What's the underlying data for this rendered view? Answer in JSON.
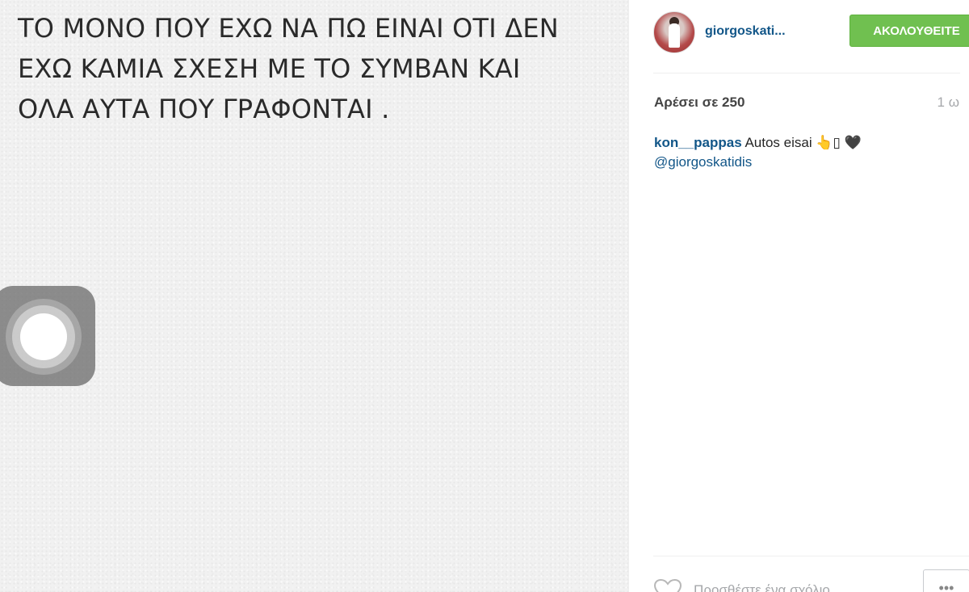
{
  "photo": {
    "caption_lines": [
      "ΤΟ ΜΟΝΟ ΠΟΥ ΕΧΩ ΝΑ ΠΩ ΕΙΝΑΙ ΟΤΙ ΔΕΝ",
      "ΕΧΩ ΚΑΜΙΑ ΣΧΕΣΗ ΜΕ ΤΟ ΣΥΜΒΑΝ ΚΑΙ",
      "ΟΛΑ ΑΥΤΑ ΠΟΥ ΓΡΑΦΟΝΤΑΙ ."
    ]
  },
  "assistive_touch": {
    "icon": "assistive-touch-icon"
  },
  "post": {
    "author_display": "giorgoskati...",
    "follow_label": "ΑΚΟΛΟΥΘΕΙΤΕ",
    "likes_label": "Αρέσει σε 250",
    "time_ago": "1 ω",
    "comments": [
      {
        "user": "kon__pappas",
        "text": "Autos eisai 👆▯ 🖤",
        "mention": "@giorgoskatidis"
      }
    ],
    "comment_placeholder": "Προσθέστε ένα σχόλιο...",
    "more_label": "•••"
  },
  "colors": {
    "follow_green": "#70c050",
    "link_blue": "#125688",
    "muted_gray": "#a5a7aa"
  },
  "icons": {
    "like": "heart-icon",
    "more": "more-options-icon",
    "avatar": "avatar"
  }
}
